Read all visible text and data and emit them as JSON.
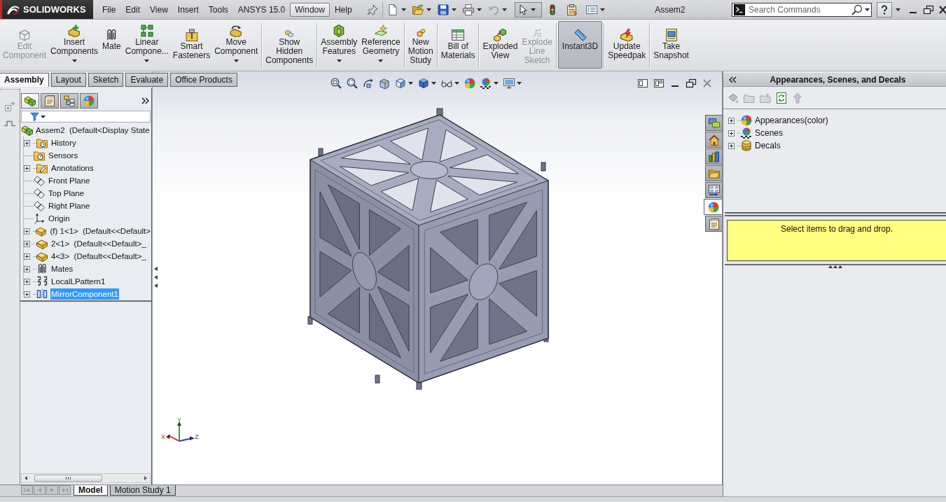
{
  "title_bar": {
    "logo": "SOLIDWORKS",
    "menu": [
      {
        "label": "File",
        "selected": false
      },
      {
        "label": "Edit",
        "selected": false
      },
      {
        "label": "View",
        "selected": false
      },
      {
        "label": "Insert",
        "selected": false
      },
      {
        "label": "Tools",
        "selected": false
      },
      {
        "label": "ANSYS 15.0",
        "selected": false
      },
      {
        "label": "Window",
        "selected": true
      },
      {
        "label": "Help",
        "selected": false
      }
    ],
    "document_title": "Assem2",
    "search": {
      "placeholder": "Search Commands"
    }
  },
  "command_manager": {
    "groups": [
      [
        {
          "label": "Edit\nComponent",
          "disabled": true,
          "selected": false,
          "dropdown": false
        },
        {
          "label": "Insert\nComponents",
          "disabled": false,
          "selected": false,
          "dropdown": true
        },
        {
          "label": "Mate",
          "disabled": false,
          "selected": false,
          "dropdown": false
        },
        {
          "label": "Linear\nCompone...",
          "disabled": false,
          "selected": false,
          "dropdown": true
        },
        {
          "label": "Smart\nFasteners",
          "disabled": false,
          "selected": false,
          "dropdown": false
        },
        {
          "label": "Move\nComponent",
          "disabled": false,
          "selected": false,
          "dropdown": true
        }
      ],
      [
        {
          "label": "Show\nHidden\nComponents",
          "disabled": false,
          "selected": false,
          "dropdown": false
        }
      ],
      [
        {
          "label": "Assembly\nFeatures",
          "disabled": false,
          "selected": false,
          "dropdown": true
        },
        {
          "label": "Reference\nGeometry",
          "disabled": false,
          "selected": false,
          "dropdown": true
        }
      ],
      [
        {
          "label": "New\nMotion\nStudy",
          "disabled": false,
          "selected": false,
          "dropdown": false
        }
      ],
      [
        {
          "label": "Bill of\nMaterials",
          "disabled": false,
          "selected": false,
          "dropdown": false
        }
      ],
      [
        {
          "label": "Exploded\nView",
          "disabled": false,
          "selected": false,
          "dropdown": false
        },
        {
          "label": "Explode\nLine\nSketch",
          "disabled": true,
          "selected": false,
          "dropdown": false
        }
      ],
      [
        {
          "label": "Instant3D",
          "disabled": false,
          "selected": true,
          "dropdown": false
        }
      ],
      [
        {
          "label": "Update\nSpeedpak",
          "disabled": false,
          "selected": false,
          "dropdown": false
        }
      ],
      [
        {
          "label": "Take\nSnapshot",
          "disabled": false,
          "selected": false,
          "dropdown": false
        }
      ]
    ],
    "tabs": [
      {
        "label": "Assembly",
        "selected": true
      },
      {
        "label": "Layout",
        "selected": false
      },
      {
        "label": "Sketch",
        "selected": false
      },
      {
        "label": "Evaluate",
        "selected": false
      },
      {
        "label": "Office Products",
        "selected": false
      }
    ]
  },
  "feature_manager": {
    "tabs": [
      {
        "selected": true
      },
      {
        "selected": false
      },
      {
        "selected": false
      },
      {
        "selected": false
      }
    ],
    "tree": {
      "label": "Assem2  (Default<Display State",
      "kind": "assembly",
      "selected": false,
      "children": [
        {
          "label": "History",
          "kind": "history",
          "selected": false,
          "expandable": true,
          "expanded": false
        },
        {
          "label": "Sensors",
          "kind": "sensors",
          "selected": false,
          "expandable": false
        },
        {
          "label": "Annotations",
          "kind": "annotations",
          "selected": false,
          "expandable": true,
          "expanded": false
        },
        {
          "label": "Front Plane",
          "kind": "plane",
          "selected": false,
          "expandable": false
        },
        {
          "label": "Top Plane",
          "kind": "plane",
          "selected": false,
          "expandable": false
        },
        {
          "label": "Right Plane",
          "kind": "plane",
          "selected": false,
          "expandable": false
        },
        {
          "label": "Origin",
          "kind": "origin",
          "selected": false,
          "expandable": false
        },
        {
          "label": "(f) 1<1>  (Default<<Default>",
          "kind": "part",
          "selected": false,
          "expandable": true,
          "expanded": false
        },
        {
          "label": "2<1>  (Default<<Default>_",
          "kind": "part",
          "selected": false,
          "expandable": true,
          "expanded": false
        },
        {
          "label": "4<3>  (Default<<Default>_",
          "kind": "part",
          "selected": false,
          "expandable": true,
          "expanded": false
        },
        {
          "label": "Mates",
          "kind": "mates",
          "selected": false,
          "expandable": true,
          "expanded": false
        },
        {
          "label": "LocalLPattern1",
          "kind": "pattern",
          "selected": false,
          "expandable": true,
          "expanded": false
        },
        {
          "label": "MirrorComponent1",
          "kind": "mirror",
          "selected": true,
          "expandable": true,
          "expanded": false
        }
      ]
    }
  },
  "viewport": {
    "triad_labels": [
      "X",
      "Y",
      "Z"
    ],
    "task_tabs": [
      {
        "selected": false
      },
      {
        "selected": false
      },
      {
        "selected": false
      },
      {
        "selected": false
      },
      {
        "selected": false
      },
      {
        "selected": true
      },
      {
        "selected": false
      }
    ]
  },
  "task_pane": {
    "title": "Appearances, Scenes, and Decals",
    "tree": [
      {
        "label": "Appearances(color)",
        "kind": "appearance",
        "expanded": false
      },
      {
        "label": "Scenes",
        "kind": "scene",
        "expanded": false
      },
      {
        "label": "Decals",
        "kind": "decal",
        "expanded": false
      }
    ],
    "message": "Select items to drag and drop."
  },
  "bottom_tabs": [
    {
      "label": "Model",
      "selected": true
    },
    {
      "label": "Motion Study 1",
      "selected": false
    }
  ]
}
